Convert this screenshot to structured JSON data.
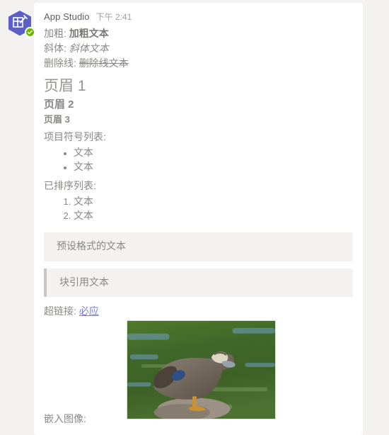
{
  "avatar": {
    "icon": "app-studio-hexagon-icon",
    "badge_icon": "green-check-badge-icon",
    "hex_color": "#5b5fc7",
    "badge_color": "#6bb700"
  },
  "message": {
    "sender": "App Studio",
    "timestamp": "下午 2:41",
    "formatting_lines": [
      {
        "label": "加粗:",
        "value": "加粗文本",
        "style": "bold"
      },
      {
        "label": "斜体:",
        "value": "斜体文本",
        "style": "italic"
      },
      {
        "label": "删除线:",
        "value": "删除线文本",
        "style": "strikethrough"
      }
    ],
    "headings": [
      {
        "level": 1,
        "text": "页眉 1"
      },
      {
        "level": 2,
        "text": "页眉 2"
      },
      {
        "level": 3,
        "text": "页眉 3"
      }
    ],
    "bullet_list": {
      "label": "项目符号列表:",
      "items": [
        "文本",
        "文本"
      ]
    },
    "ordered_list": {
      "label": "已排序列表:",
      "items": [
        "文本",
        "文本"
      ]
    },
    "preformatted": "预设格式的文本",
    "blockquote": "块引用文本",
    "hyperlink": {
      "label": "超链接:",
      "link_text": "必应",
      "link_color": "#7a7ae0"
    },
    "embedded_image": {
      "label": "嵌入图像:",
      "alt": "duck-standing-on-rock-photo"
    }
  },
  "colors": {
    "page_background": "#f3f2f1",
    "card_background": "#ffffff",
    "body_text": "#8a8886",
    "sender_text": "#605e5c",
    "timestamp_text": "#a19f9d",
    "block_background": "#f3f2f1",
    "quote_bar": "#c8c6c4"
  }
}
